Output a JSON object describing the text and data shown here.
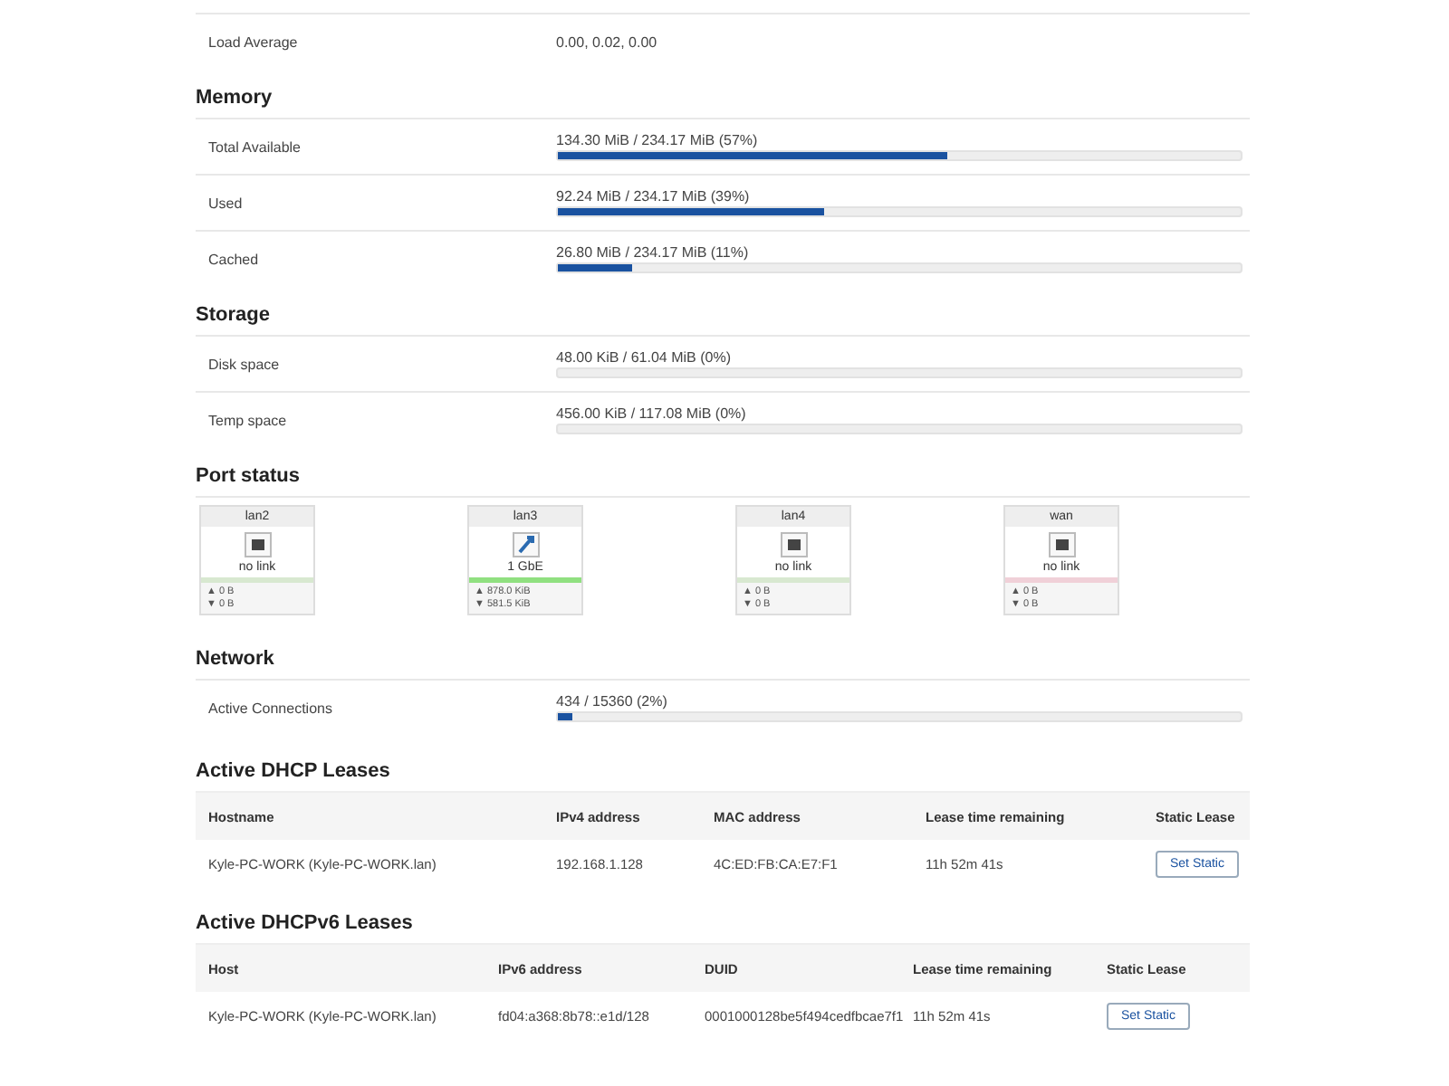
{
  "system_rows": [
    {
      "label": "Load Average",
      "value": "0.00, 0.02, 0.00"
    }
  ],
  "sections": [
    {
      "title": "Memory",
      "rows": [
        {
          "label": "Total Available",
          "reading": "134.30 MiB / 234.17 MiB (57%)",
          "level": 0.57
        },
        {
          "label": "Used",
          "reading": "92.24 MiB / 234.17 MiB (39%)",
          "level": 0.39
        },
        {
          "label": "Cached",
          "reading": "26.80 MiB / 234.17 MiB (11%)",
          "level": 0.11
        }
      ]
    },
    {
      "title": "Storage",
      "rows": [
        {
          "label": "Disk space",
          "reading": "48.00 KiB / 61.04 MiB (0%)",
          "level": 0
        },
        {
          "label": "Temp space",
          "reading": "456.00 KiB / 117.08 MiB (0%)",
          "level": 0
        }
      ]
    }
  ],
  "port_status": {
    "title": "Port status",
    "ports": [
      {
        "name": "lan2",
        "linked": false,
        "status": "no link",
        "color": "#d8e8d0",
        "tx": "▲ 0 B",
        "rx": "▼ 0 B"
      },
      {
        "name": "lan3",
        "linked": true,
        "status": "1 GbE",
        "color": "#90e080",
        "tx": "▲ 878.0 KiB",
        "rx": "▼ 581.5 KiB"
      },
      {
        "name": "lan4",
        "linked": false,
        "status": "no link",
        "color": "#d8e8d0",
        "tx": "▲ 0 B",
        "rx": "▼ 0 B"
      },
      {
        "name": "wan",
        "linked": false,
        "status": "no link",
        "color": "#f0d0d8",
        "tx": "▲ 0 B",
        "rx": "▼ 0 B"
      }
    ]
  },
  "network": {
    "title": "Network",
    "rows": [
      {
        "label": "Active Connections",
        "reading": "434 / 15360 (2%)",
        "level": 0.02
      }
    ]
  },
  "tables": [
    {
      "title": "Active DHCP Leases",
      "columns": [
        "Hostname",
        "IPv4 address",
        "MAC address",
        "Lease time remaining",
        "Static Lease"
      ],
      "rows": [
        {
          "cells": [
            "Kyle-PC-WORK (Kyle-PC-WORK.lan)",
            "192.168.1.128",
            "4C:ED:FB:CA:E7:F1",
            "11h 52m 41s"
          ],
          "button": "Set Static"
        }
      ]
    },
    {
      "title": "Active DHCPv6 Leases",
      "columns": [
        "Host",
        "IPv6 address",
        "DUID",
        "Lease time remaining",
        "Static Lease"
      ],
      "rows": [
        {
          "cells": [
            "Kyle-PC-WORK (Kyle-PC-WORK.lan)",
            "fd04:a368:8b78::e1d/128",
            "0001000128be5f494cedfbcae7f1",
            "11h 52m 41s"
          ],
          "button": "Set Static"
        }
      ]
    }
  ]
}
